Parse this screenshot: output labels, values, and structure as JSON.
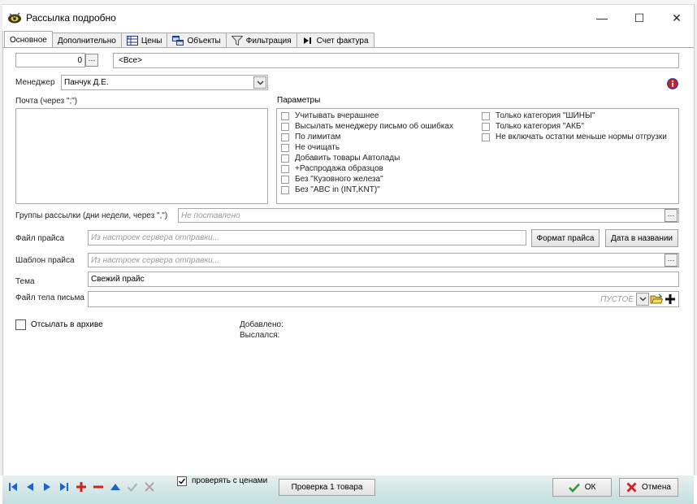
{
  "window": {
    "title": "Рассылка подробно",
    "minimize": "—",
    "maximize": "☐",
    "close": "✕"
  },
  "tabs": [
    {
      "label": "Основное",
      "icon": ""
    },
    {
      "label": "Дополнительно",
      "icon": ""
    },
    {
      "label": "Цены",
      "icon": "price-table-icon"
    },
    {
      "label": "Объекты",
      "icon": "objects-icon"
    },
    {
      "label": "Фильтрация",
      "icon": "funnel-icon"
    },
    {
      "label": "Счет фактура",
      "icon": "arrow-bar-icon"
    }
  ],
  "top": {
    "number_value": "0",
    "dots": "···",
    "all_value": "<Все>"
  },
  "manager": {
    "label": "Менеджер",
    "value": "Панчук Д.Е."
  },
  "mail": {
    "label": "Почта (через \";\")",
    "value": ""
  },
  "params": {
    "label": "Параметры",
    "left": [
      "Учитывать вчерашнее",
      "Высылать менеджеру письмо об ошибках",
      "По лимитам",
      "Не очищать",
      "Добавить товары Автолады",
      "+Распродажа образцов",
      "Без \"Кузовного железа\"",
      "Без \"ABC in (INT,KNT)\""
    ],
    "right": [
      "Только категория \"ШИНЫ\"",
      "Только категория \"АКБ\"",
      "Не включать остатки меньше нормы отгрузки"
    ]
  },
  "groups": {
    "label": "Группы рассылки (дни недели, через \",\")",
    "placeholder": "Не поставлено"
  },
  "price_file": {
    "label": "Файл прайса",
    "placeholder": "Из настроек сервера отправки...",
    "format_button": "Формат прайса",
    "date_button": "Дата в названии"
  },
  "price_template": {
    "label": "Шаблон прайса",
    "placeholder": "Из настроек сервера отправки..."
  },
  "subject": {
    "label": "Тема",
    "value": "Свежий прайс"
  },
  "body_file": {
    "label": "Файл тела письма",
    "placeholder": "ПУСТОЕ"
  },
  "archive": {
    "label": "Отсылать в архиве"
  },
  "info": {
    "added_label": "Добавлено:",
    "sent_label": "Выслался:"
  },
  "bottom": {
    "check_prices_label": "проверять с ценами",
    "check_button": "Проверка 1 товара",
    "ok_label": "ОК",
    "cancel_label": "Отмена"
  },
  "colors": {
    "accent_red": "#cc2222",
    "accent_blue": "#1c64c8",
    "ok_green": "#2f9a2f",
    "toolbar_teal": "#c2dede"
  }
}
